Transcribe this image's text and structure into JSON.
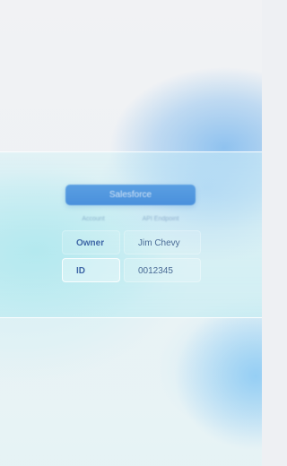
{
  "card": {
    "title": "Salesforce",
    "columns": [
      "Account",
      "API Endpoint"
    ],
    "rows": [
      {
        "label": "Owner",
        "value": "Jim Chevy"
      },
      {
        "label": "ID",
        "value": "0012345"
      }
    ]
  }
}
